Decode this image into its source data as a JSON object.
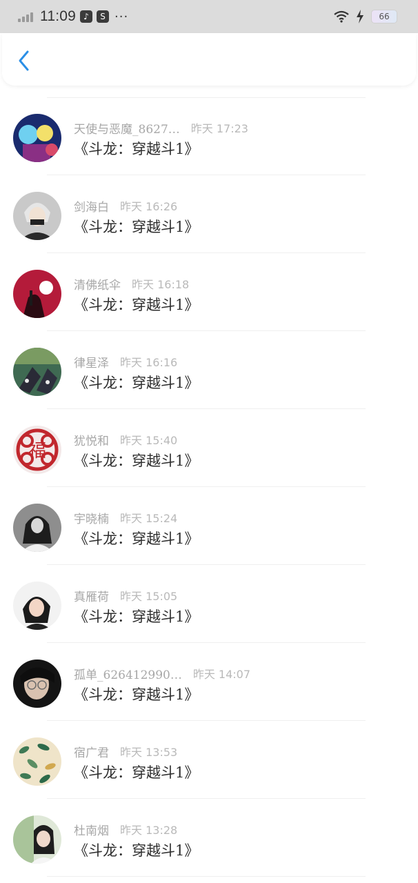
{
  "status_bar": {
    "time": "11:09",
    "dots": "···",
    "battery": "66"
  },
  "header": {
    "back_icon": "chevron-left-icon"
  },
  "colors": {
    "accent": "#2b8fe6",
    "status_bg": "#dcdcdc"
  },
  "items": [
    {
      "name": "天使与恶魔_8627…",
      "time": "昨天 17:23",
      "title": "《斗龙：穿越斗1》"
    },
    {
      "name": "剑海白",
      "time": "昨天 16:26",
      "title": "《斗龙：穿越斗1》"
    },
    {
      "name": "清佛纸伞",
      "time": "昨天 16:18",
      "title": "《斗龙：穿越斗1》"
    },
    {
      "name": "律星泽",
      "time": "昨天 16:16",
      "title": "《斗龙：穿越斗1》"
    },
    {
      "name": "犹悦和",
      "time": "昨天 15:40",
      "title": "《斗龙：穿越斗1》"
    },
    {
      "name": "宇晓楠",
      "time": "昨天 15:24",
      "title": "《斗龙：穿越斗1》"
    },
    {
      "name": "真雁荷",
      "time": "昨天 15:05",
      "title": "《斗龙：穿越斗1》"
    },
    {
      "name": "孤单_626412990…",
      "time": "昨天 14:07",
      "title": "《斗龙：穿越斗1》"
    },
    {
      "name": "宿广君",
      "time": "昨天 13:53",
      "title": "《斗龙：穿越斗1》"
    },
    {
      "name": "杜南烟",
      "time": "昨天 13:28",
      "title": "《斗龙：穿越斗1》"
    }
  ]
}
